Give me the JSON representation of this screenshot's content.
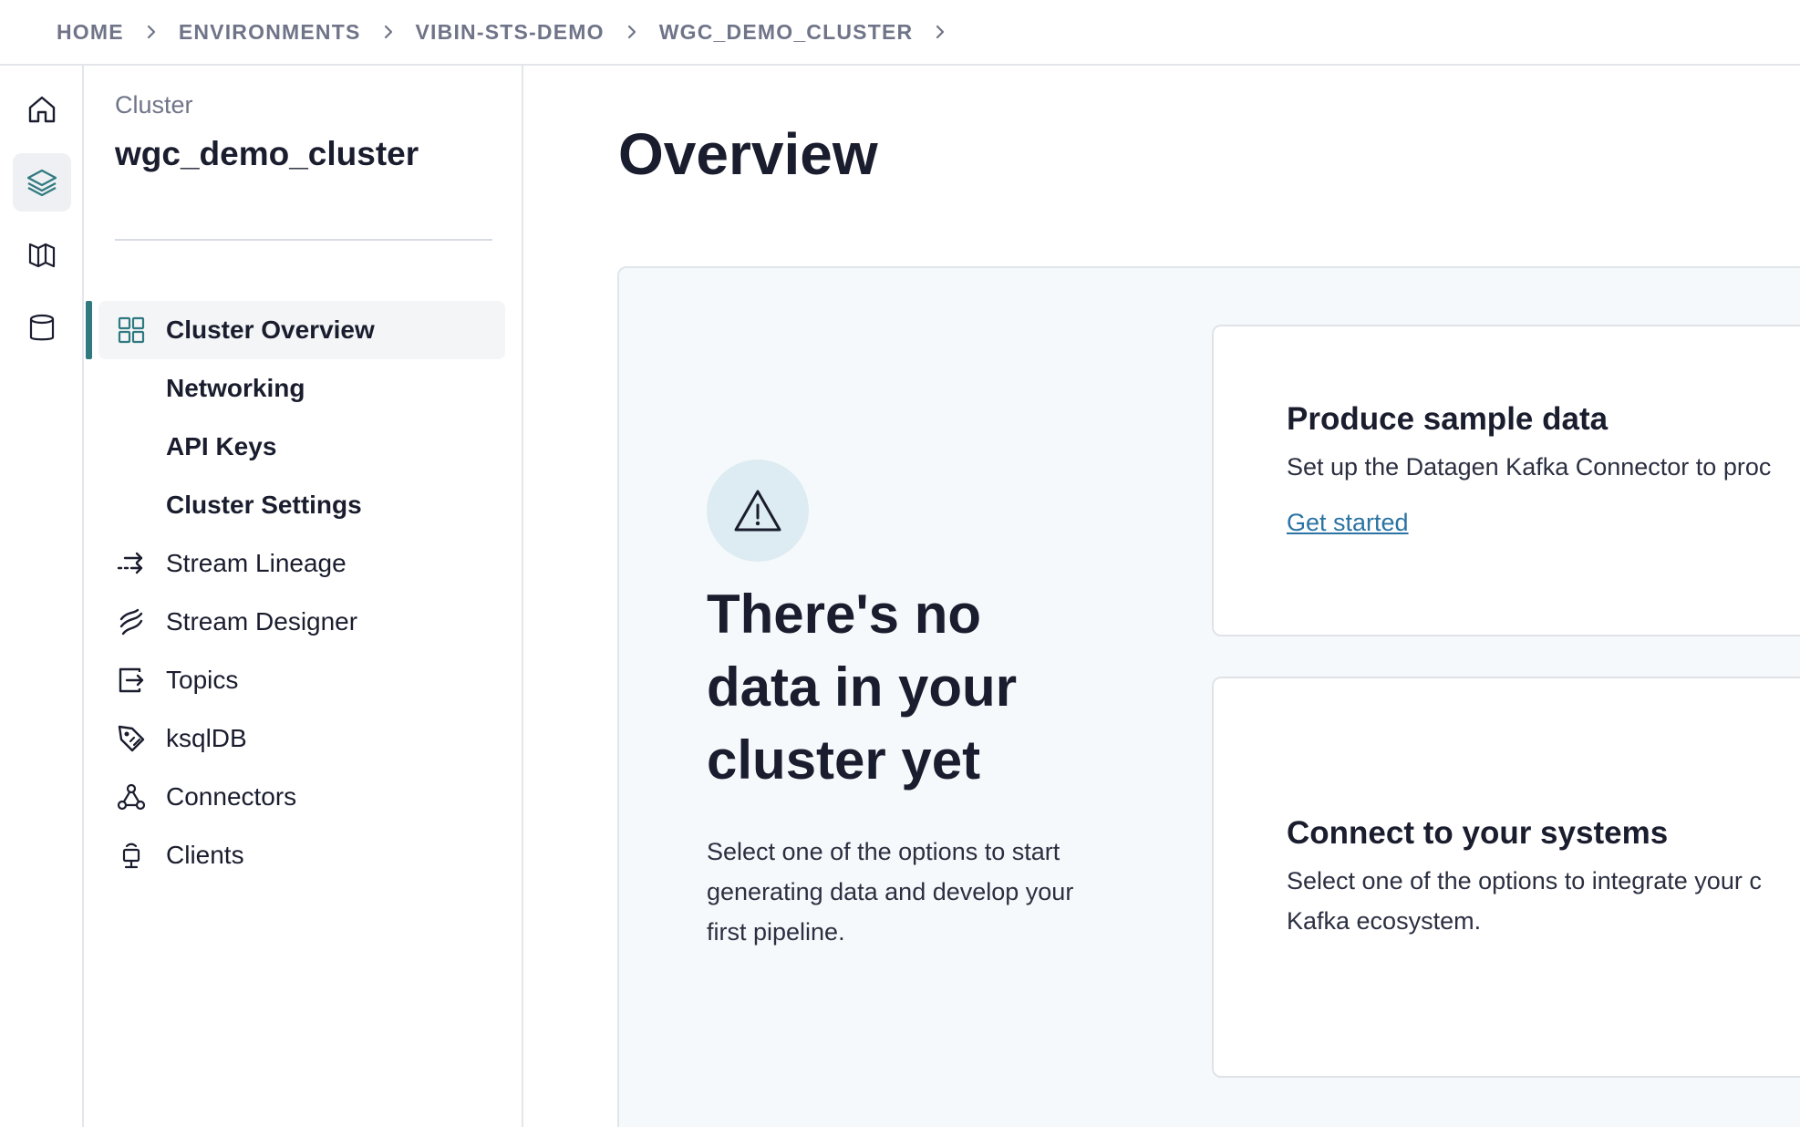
{
  "breadcrumb": {
    "items": [
      "HOME",
      "ENVIRONMENTS",
      "VIBIN-STS-DEMO",
      "WGC_DEMO_CLUSTER"
    ]
  },
  "rail": {
    "icons": [
      "home-icon",
      "layers-icon",
      "map-icon",
      "database-icon"
    ],
    "active": "layers-icon"
  },
  "sidebar": {
    "kicker": "Cluster",
    "title": "wgc_demo_cluster",
    "items": [
      {
        "label": "Cluster Overview",
        "icon": "grid-icon",
        "active": true
      },
      {
        "label": "Networking"
      },
      {
        "label": "API Keys"
      },
      {
        "label": "Cluster Settings"
      },
      {
        "label": "Stream Lineage",
        "icon": "lineage-icon"
      },
      {
        "label": "Stream Designer",
        "icon": "designer-icon"
      },
      {
        "label": "Topics",
        "icon": "topics-icon"
      },
      {
        "label": "ksqlDB",
        "icon": "ksqldb-icon"
      },
      {
        "label": "Connectors",
        "icon": "connectors-icon"
      },
      {
        "label": "Clients",
        "icon": "clients-icon"
      }
    ]
  },
  "main": {
    "title": "Overview",
    "empty_state": {
      "icon": "warning-icon",
      "heading": "There's no data in your cluster yet",
      "description": "Select one of the options to start generating data and develop your first pipeline."
    },
    "cards": [
      {
        "title": "Produce sample data",
        "text": "Set up the Datagen Kafka Connector to proc",
        "link": "Get started"
      },
      {
        "title": "Connect to your systems",
        "text_lines": [
          "Select one of the options to integrate your c",
          "Kafka ecosystem."
        ]
      }
    ]
  },
  "colors": {
    "accent": "#2f7a80",
    "link": "#2a73a3",
    "panel_bg": "#f6f9fb",
    "icon_circle": "#dcecf2"
  }
}
